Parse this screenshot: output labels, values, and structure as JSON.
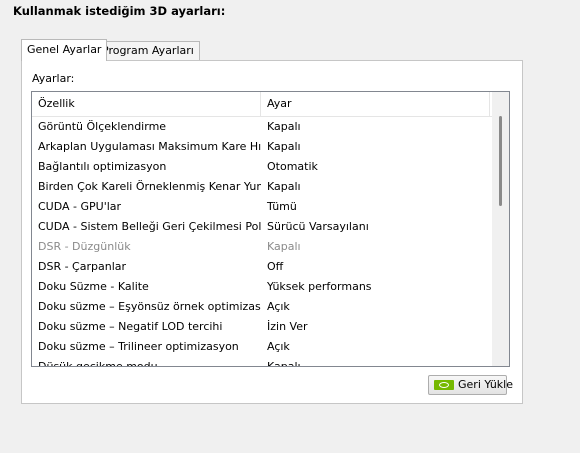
{
  "heading": "Kullanmak istediğim 3D ayarları:",
  "tabs": [
    {
      "label": "Genel Ayarlar",
      "active": true
    },
    {
      "label": "Program Ayarları",
      "active": false
    }
  ],
  "settings_label": "Ayarlar:",
  "table": {
    "columns": [
      "Özellik",
      "Ayar"
    ],
    "rows": [
      {
        "feature": "Görüntü Ölçeklendirme",
        "value": "Kapalı",
        "disabled": false
      },
      {
        "feature": "Arkaplan Uygulaması Maksimum Kare Hızı",
        "value": "Kapalı",
        "disabled": false
      },
      {
        "feature": "Bağlantılı optimizasyon",
        "value": "Otomatik",
        "disabled": false
      },
      {
        "feature": "Birden Çok Kareli Örneklenmiş Kenar Yumu...",
        "value": "Kapalı",
        "disabled": false
      },
      {
        "feature": "CUDA - GPU'lar",
        "value": "Tümü",
        "disabled": false
      },
      {
        "feature": "CUDA - Sistem Belleği Geri Çekilmesi Politikası",
        "value": "Sürücü Varsayılanı",
        "disabled": false
      },
      {
        "feature": "DSR - Düzgünlük",
        "value": "Kapalı",
        "disabled": true
      },
      {
        "feature": "DSR - Çarpanlar",
        "value": "Off",
        "disabled": false
      },
      {
        "feature": "Doku Süzme - Kalite",
        "value": "Yüksek performans",
        "disabled": false
      },
      {
        "feature": "Doku süzme – Eşyönsüz örnek optimizasyonu",
        "value": "Açık",
        "disabled": false
      },
      {
        "feature": "Doku süzme – Negatif LOD tercihi",
        "value": "İzin Ver",
        "disabled": false
      },
      {
        "feature": "Doku süzme – Trilineer optimizasyon",
        "value": "Açık",
        "disabled": false
      },
      {
        "feature": "Düşük gecikme modu",
        "value": "Kapalı",
        "disabled": false
      }
    ]
  },
  "restore_button": {
    "label": "Geri Yükle",
    "icon": "nvidia-icon"
  },
  "colors": {
    "background": "#f0f0f0",
    "panel": "#ffffff",
    "disabled_text": "#8a8a8a",
    "nvidia_green": "#76b900"
  }
}
